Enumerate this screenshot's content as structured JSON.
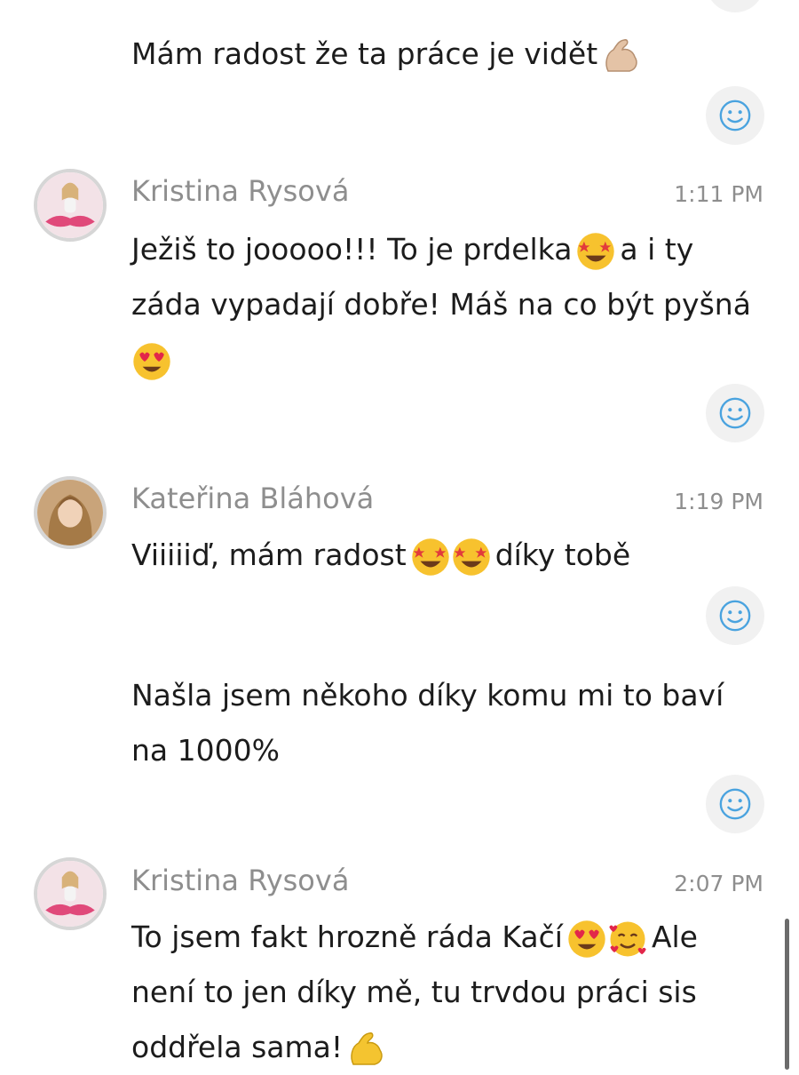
{
  "messages": [
    {
      "text": "Mám radost že ta práce je vidět"
    },
    {
      "author": "Kristina Rysová",
      "time": "1:11 PM",
      "line1": "Ježiš to jooooo!!! To je prdelka",
      "line1b": "a i ty",
      "line2": "záda vypadají dobře! Máš na co být pyšná"
    },
    {
      "author": "Kateřina Bláhová",
      "time": "1:19 PM",
      "line1": "Viiiiiď, mám radost",
      "line1b": "díky tobě"
    },
    {
      "line1": "Našla jsem někoho díky komu mi to baví",
      "line2": "na 1000%"
    },
    {
      "author": "Kristina Rysová",
      "time": "2:07 PM",
      "line1": "To jsem fakt hrozně ráda Kačí",
      "line1b": "Ale",
      "line2": "není to jen díky mě, tu trvdou práci sis",
      "line3": "oddřela sama!"
    }
  ],
  "icons": {
    "react": "smiley-icon",
    "muscle": "flexed-biceps-icon",
    "star_struck": "star-struck-emoji-icon",
    "heart_eyes": "heart-eyes-emoji-icon",
    "smiling_hearts": "smiling-face-with-hearts-icon"
  },
  "colors": {
    "meta_text": "#8e8e8e",
    "react_bg": "#f1f1f1",
    "react_icon": "#4aa3df"
  }
}
